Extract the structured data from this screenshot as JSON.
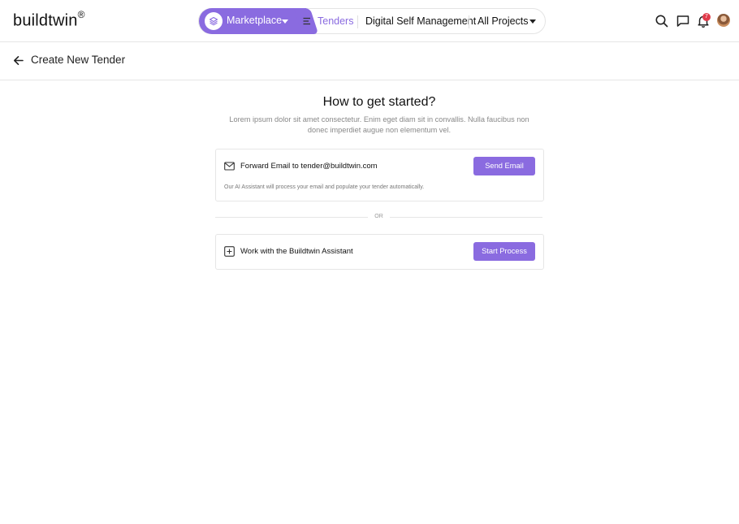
{
  "app": {
    "logo_text": "buildtwin",
    "logo_mark": "®"
  },
  "nav": {
    "marketplace_label": "Marketplace",
    "tenders_label": "Tenders",
    "digital_self_management_label": "Digital Self Management",
    "all_projects_label": "All Projects"
  },
  "topbar": {
    "notification_count": "7",
    "icons": [
      "search-icon",
      "chat-icon",
      "bell-icon",
      "avatar"
    ]
  },
  "page": {
    "title": "Create New Tender"
  },
  "intro": {
    "heading": "How to get started?",
    "subtext": "Lorem ipsum dolor sit amet consectetur. Enim eget diam sit in convallis. Nulla faucibus non donec imperdiet augue non elementum vel."
  },
  "email_option": {
    "title": "Forward Email to tender@buildtwin.com",
    "button_label": "Send Email",
    "note": "Our AI Assistant will process your email and populate your tender automatically."
  },
  "divider": {
    "label": "OR"
  },
  "assistant_option": {
    "title": "Work with the Buildtwin Assistant",
    "button_label": "Start Process"
  },
  "colors": {
    "accent": "#8a6be0",
    "badge": "#e03a4a",
    "border": "#e6e6e6"
  }
}
